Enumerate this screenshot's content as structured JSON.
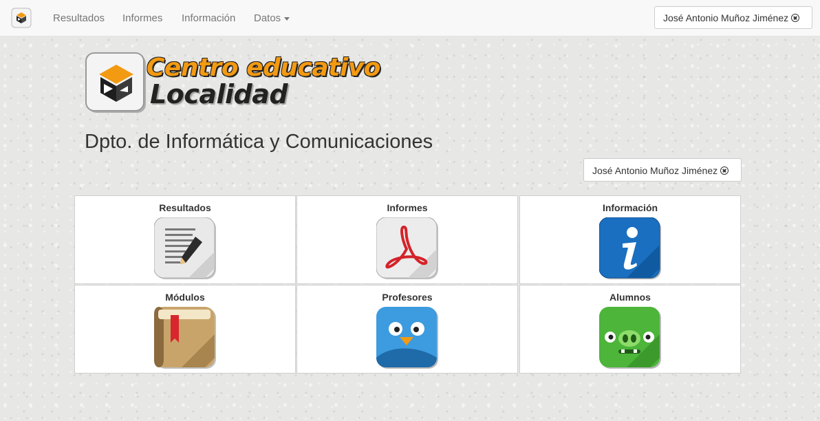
{
  "navbar": {
    "logo_icon": "school-cube-logo-icon",
    "items": [
      "Resultados",
      "Informes",
      "Información",
      "Datos"
    ],
    "user": "José Antonio Muñoz Jiménez"
  },
  "header": {
    "brand_line1": "Centro educativo",
    "brand_line2": "Localidad",
    "department": "Dpto. de Informática y Comunicaciones",
    "user": "José Antonio Muñoz Jiménez"
  },
  "tiles": [
    {
      "label": "Resultados",
      "icon": "notepad-pencil-icon"
    },
    {
      "label": "Informes",
      "icon": "pdf-document-icon"
    },
    {
      "label": "Información",
      "icon": "info-icon"
    },
    {
      "label": "Módulos",
      "icon": "book-icon"
    },
    {
      "label": "Profesores",
      "icon": "bird-icon"
    },
    {
      "label": "Alumnos",
      "icon": "green-pig-icon"
    }
  ],
  "colors": {
    "accent": "#f39a13",
    "navbar_bg": "#f8f8f8",
    "info_blue": "#1a6fc0",
    "pig_green": "#4cb53a"
  }
}
